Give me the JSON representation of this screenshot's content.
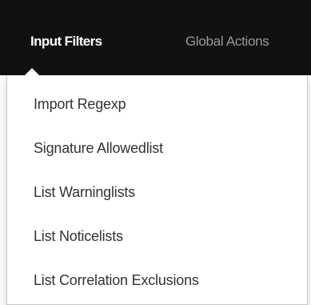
{
  "navbar": {
    "tabs": [
      {
        "label": "Input Filters",
        "active": true
      },
      {
        "label": "Global Actions",
        "active": false
      }
    ]
  },
  "dropdown": {
    "items": [
      {
        "label": "Import Regexp"
      },
      {
        "label": "Signature Allowedlist"
      },
      {
        "label": "List Warninglists"
      },
      {
        "label": "List Noticelists"
      },
      {
        "label": "List Correlation Exclusions"
      }
    ]
  },
  "colors": {
    "navbar_bg": "#111111",
    "active_tab_text": "#ffffff",
    "inactive_tab_text": "#9a9a9a",
    "menu_text": "#333333",
    "menu_bg": "#ffffff"
  }
}
